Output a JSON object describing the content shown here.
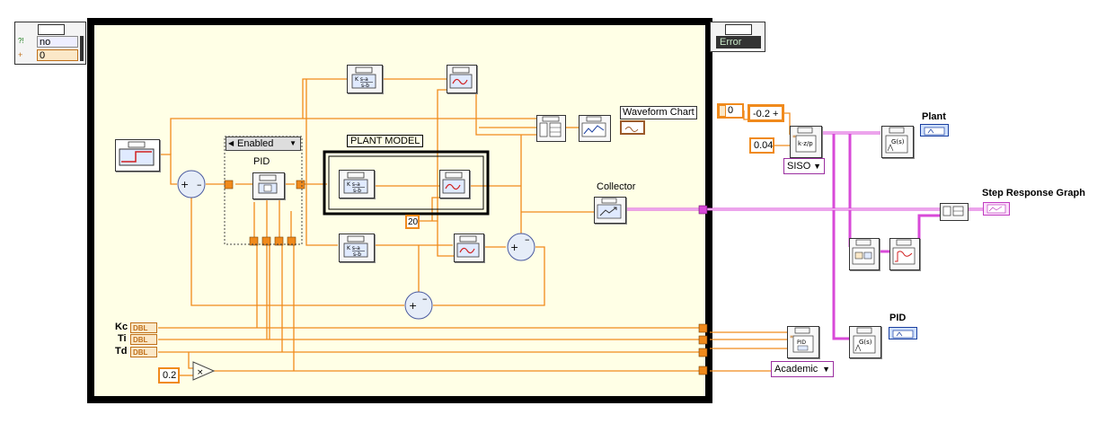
{
  "diagram": {
    "error_cluster_left": {
      "status_value": "no",
      "code_value": "0",
      "status_glyph": "?!",
      "code_glyph": "+"
    },
    "error_cluster_right": {
      "value": "Error"
    },
    "case_selector": {
      "value": "Enabled",
      "left_arrow": "◀",
      "down_arrow": "▼"
    },
    "labels": {
      "pid": "PID",
      "plant_model": "PLANT MODEL",
      "waveform_chart": "Waveform Chart",
      "collector": "Collector",
      "plant": "Plant",
      "step_response_graph": "Step Response Graph",
      "pid_out": "PID"
    },
    "constants": {
      "twenty": "20",
      "zero_two": "0.2",
      "zero": "0",
      "neg_zero_two": "-0.2 +",
      "zero_zero_four": "0.04"
    },
    "enums": {
      "siso": "SISO",
      "academic": "Academic"
    },
    "controls": [
      {
        "name": "Kc",
        "type": "DBL"
      },
      {
        "name": "Ti",
        "type": "DBL"
      },
      {
        "name": "Td",
        "type": "DBL"
      }
    ],
    "glyphs": {
      "tf": "s-a / s-b",
      "gs": "G(s)",
      "k": "k·z/p"
    }
  }
}
